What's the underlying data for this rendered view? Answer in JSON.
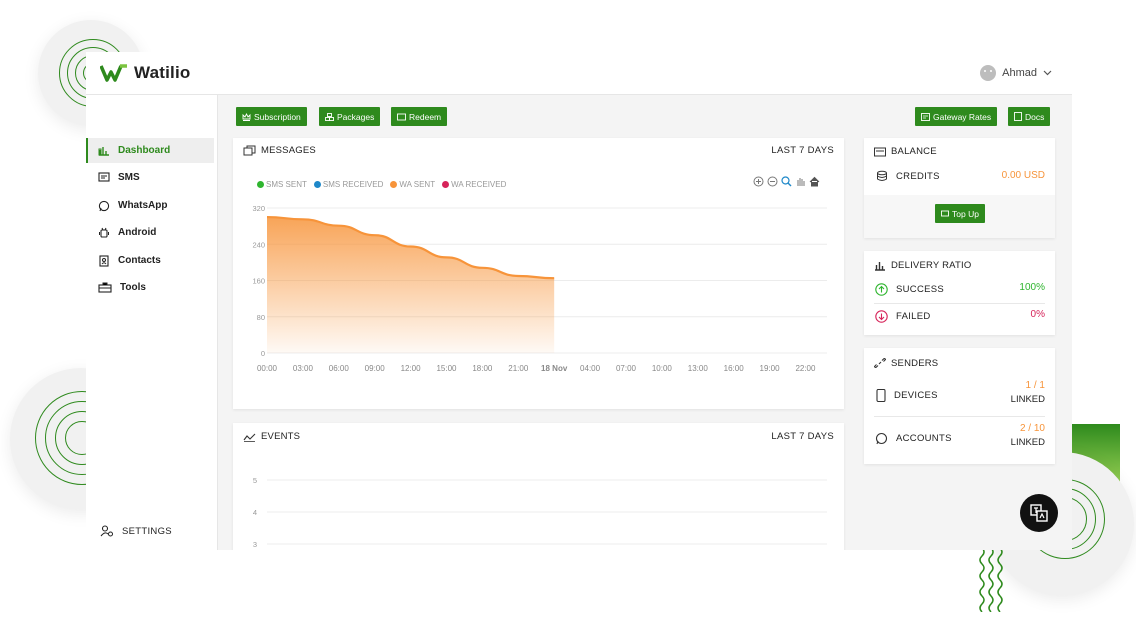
{
  "brand": {
    "name": "Watilio"
  },
  "user": {
    "name": "Ahmad"
  },
  "sidebar": {
    "items": [
      {
        "label": "Dashboard",
        "icon": "bar-chart-icon"
      },
      {
        "label": "SMS",
        "icon": "message-icon"
      },
      {
        "label": "WhatsApp",
        "icon": "whatsapp-icon"
      },
      {
        "label": "Android",
        "icon": "android-icon"
      },
      {
        "label": "Contacts",
        "icon": "contacts-icon"
      },
      {
        "label": "Tools",
        "icon": "toolbox-icon"
      }
    ],
    "settings_label": "SETTINGS"
  },
  "toolbar": {
    "subscription": "Subscription",
    "packages": "Packages",
    "redeem": "Redeem",
    "gateway_rates": "Gateway Rates",
    "docs": "Docs"
  },
  "messages": {
    "title": "MESSAGES",
    "period": "LAST 7 DAYS",
    "legend": [
      "SMS SENT",
      "SMS RECEIVED",
      "WA SENT",
      "WA RECEIVED"
    ]
  },
  "events": {
    "title": "EVENTS",
    "period": "LAST 7 DAYS",
    "yticks": [
      "5",
      "4",
      "3"
    ]
  },
  "balance": {
    "title": "BALANCE",
    "credits_label": "CREDITS",
    "credits_value": "0.00 USD",
    "topup": "Top Up"
  },
  "delivery": {
    "title": "DELIVERY RATIO",
    "success_label": "SUCCESS",
    "success_value": "100%",
    "failed_label": "FAILED",
    "failed_value": "0%"
  },
  "senders": {
    "title": "SENDERS",
    "devices_label": "DEVICES",
    "devices_value": "1 / 1",
    "devices_sub": "LINKED",
    "accounts_label": "ACCOUNTS",
    "accounts_value": "2 / 10",
    "accounts_sub": "LINKED"
  },
  "colors": {
    "brand": "#2e8a1d",
    "sms_sent": "#2fb52f",
    "sms_received": "#1e88c9",
    "wa_sent": "#f7943a",
    "wa_received": "#d6245a",
    "success": "#2fb52f",
    "failed": "#d6245a",
    "credits": "#f7943a",
    "senders_value": "#f7943a"
  },
  "chart_data": {
    "type": "area",
    "categories": [
      "00:00",
      "03:00",
      "06:00",
      "09:00",
      "12:00",
      "15:00",
      "18:00",
      "21:00",
      "18 Nov",
      "04:00",
      "07:00",
      "10:00",
      "13:00",
      "16:00",
      "19:00",
      "22:00"
    ],
    "yticks": [
      "320",
      "240",
      "160",
      "80",
      "0"
    ],
    "ylim": [
      0,
      320
    ],
    "series": [
      {
        "name": "SMS SENT",
        "x": [],
        "values": []
      },
      {
        "name": "SMS RECEIVED",
        "x": [],
        "values": []
      },
      {
        "name": "WA SENT",
        "x": [
          0,
          3,
          6,
          9,
          12,
          15,
          18,
          21,
          24
        ],
        "values": [
          300,
          295,
          281,
          260,
          235,
          211,
          188,
          170,
          165
        ]
      },
      {
        "name": "WA RECEIVED",
        "x": [],
        "values": []
      }
    ]
  }
}
